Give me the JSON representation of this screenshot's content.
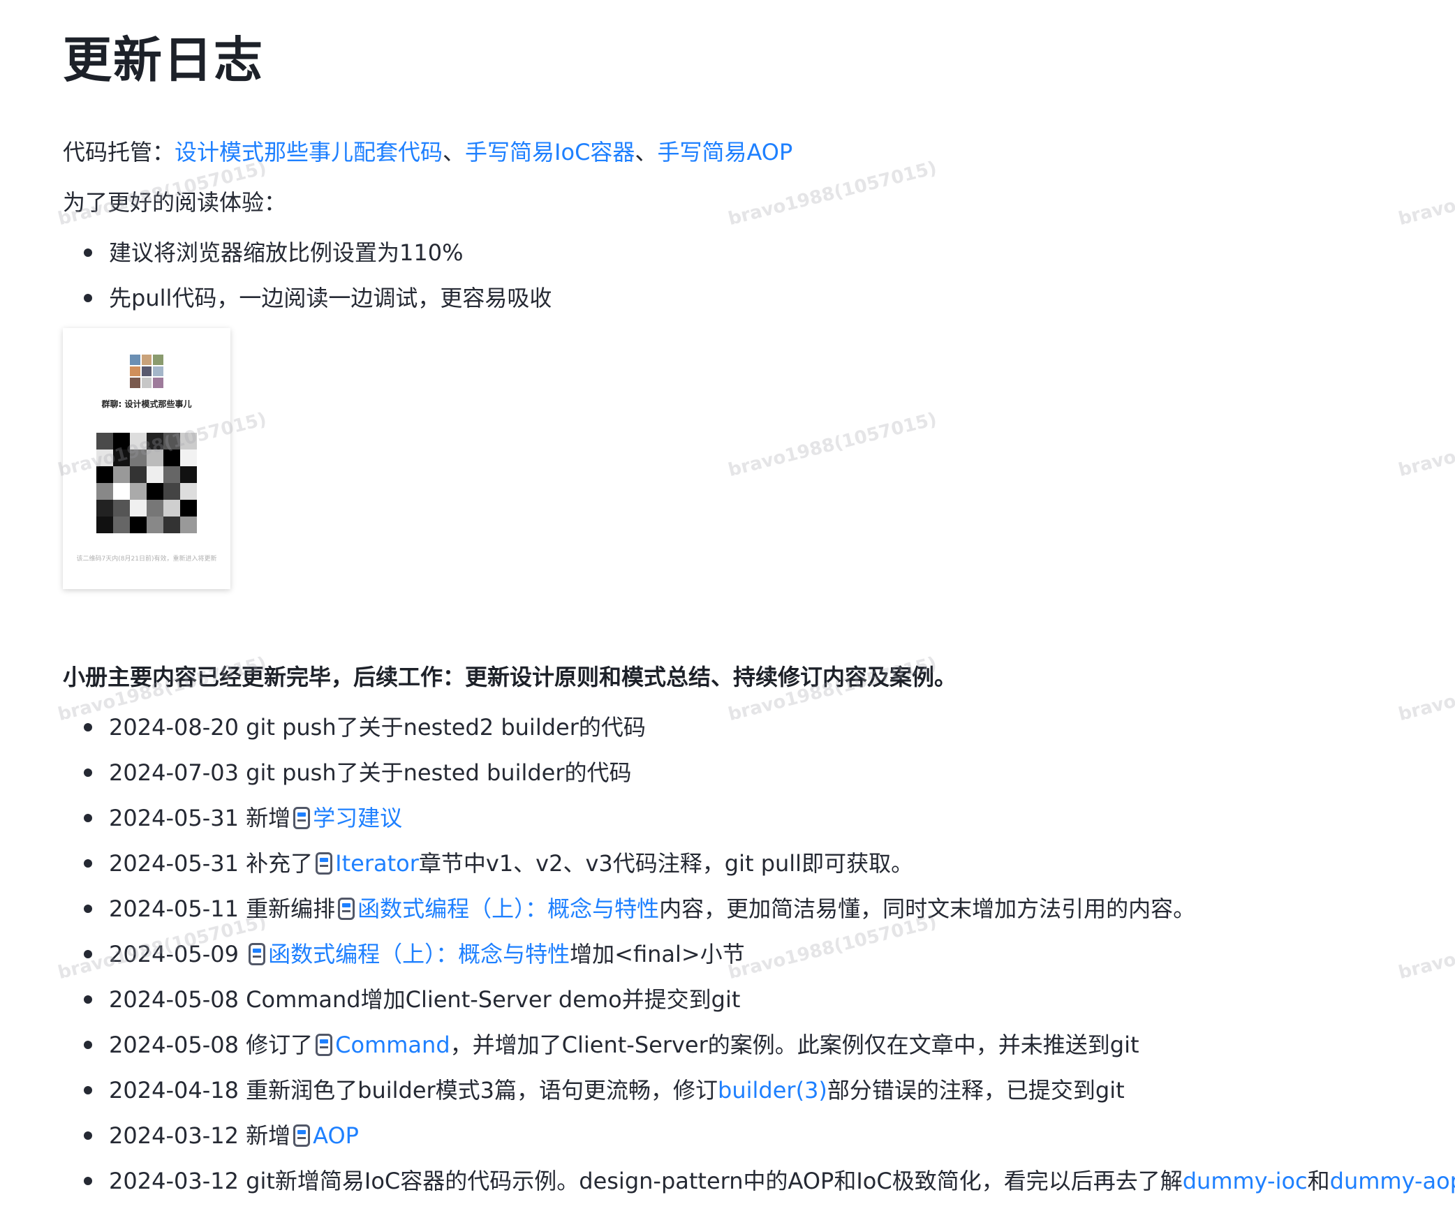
{
  "title": "更新日志",
  "hosting": {
    "prefix": "代码托管：",
    "links": [
      "设计模式那些事儿配套代码",
      "手写简易IoC容器",
      "手写简易AOP"
    ],
    "sep": "、"
  },
  "reading": {
    "intro": "为了更好的阅读体验：",
    "tips": [
      "建议将浏览器缩放比例设置为110%",
      "先pull代码，一边阅读一边调试，更容易吸收"
    ]
  },
  "qr_card": {
    "group_name": "群聊: 设计模式那些事儿",
    "note": "该二维码7天内(8月21日前)有效，重新进入将更新"
  },
  "summary": "小册主要内容已经更新完毕，后续工作：更新设计原则和模式总结、持续修订内容及案例。",
  "log": [
    {
      "pre": "2024-08-20 git push了关于nested2 builder的代码"
    },
    {
      "pre": "2024-07-03 git push了关于nested builder的代码"
    },
    {
      "pre": "2024-05-31 新增",
      "icon": true,
      "link": "学习建议",
      "post": ""
    },
    {
      "pre": "2024-05-31 补充了",
      "icon": true,
      "link": "Iterator",
      "post": "章节中v1、v2、v3代码注释，git pull即可获取。"
    },
    {
      "pre": "2024-05-11 重新编排",
      "icon": true,
      "link": "函数式编程（上）：概念与特性",
      "post": "内容，更加简洁易懂，同时文末增加方法引用的内容。"
    },
    {
      "pre": "2024-05-09 ",
      "icon": true,
      "link": "函数式编程（上）：概念与特性",
      "post": "增加<final>小节"
    },
    {
      "pre": "2024-05-08 Command增加Client-Server demo并提交到git"
    },
    {
      "pre": "2024-05-08 修订了",
      "icon": true,
      "link": "Command",
      "post": "，并增加了Client-Server的案例。此案例仅在文章中，并未推送到git"
    },
    {
      "pre": "2024-04-18 重新润色了builder模式3篇，语句更流畅，修订",
      "link": "builder(3)",
      "post": "部分错误的注释，已提交到git"
    },
    {
      "pre": "2024-03-12 新增",
      "icon": true,
      "link": "AOP",
      "post": ""
    },
    {
      "pre": "2024-03-12 git新增简易IoC容器的代码示例。design-pattern中的AOP和IoC极致简化，看完以后再去了解",
      "link": "dummy-ioc",
      "mid": "和",
      "link2": "dummy-aop"
    }
  ],
  "watermark": "bravo1988(1057015)",
  "colors": {
    "link": "#1e80ff",
    "text": "#252933"
  }
}
